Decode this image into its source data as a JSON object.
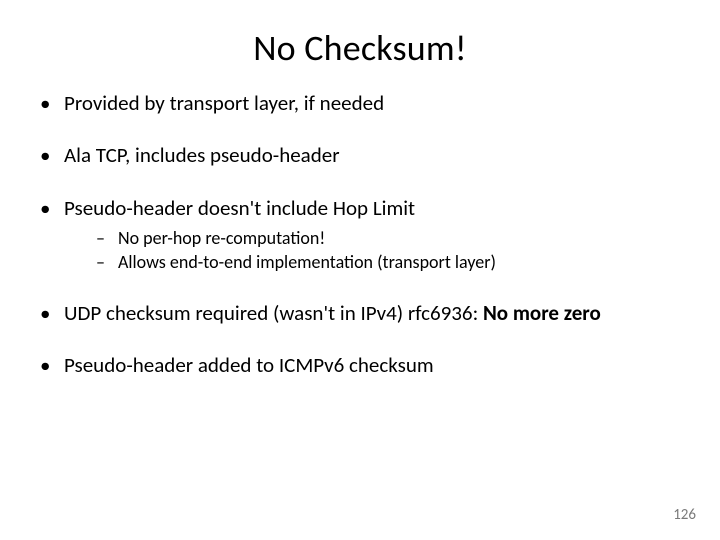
{
  "title": "No Checksum!",
  "bullets": {
    "b1": "Provided by transport layer, if needed",
    "b2": "Ala TCP, includes pseudo-header",
    "b3": "Pseudo-header doesn't include Hop Limit",
    "b3_sub1": "No per-hop re-computation!",
    "b3_sub2": "Allows end-to-end implementation (transport layer)",
    "b4_pre": "UDP checksum required (wasn't in IPv4) rfc6936: ",
    "b4_bold": "No more zero",
    "b5": "Pseudo-header added to ICMPv6 checksum"
  },
  "page_number": "126"
}
